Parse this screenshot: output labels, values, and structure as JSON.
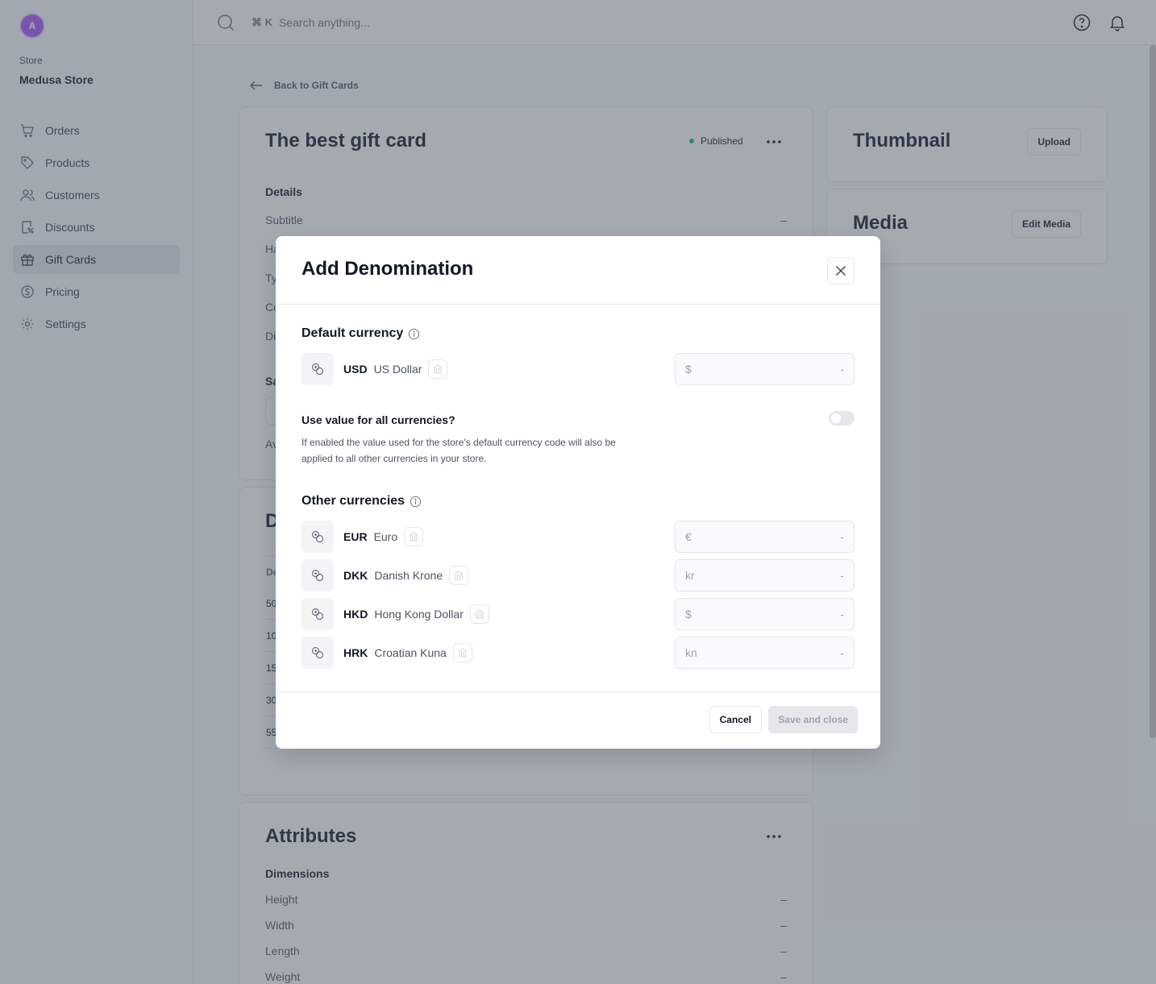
{
  "sidebar": {
    "avatar_initial": "A",
    "store_label": "Store",
    "store_name": "Medusa Store",
    "items": [
      {
        "label": "Orders",
        "icon": "cart-icon"
      },
      {
        "label": "Products",
        "icon": "tag-icon"
      },
      {
        "label": "Customers",
        "icon": "users-icon"
      },
      {
        "label": "Discounts",
        "icon": "discount-icon"
      },
      {
        "label": "Gift Cards",
        "icon": "gift-icon",
        "active": true
      },
      {
        "label": "Pricing",
        "icon": "dollar-icon"
      },
      {
        "label": "Settings",
        "icon": "gear-icon"
      }
    ]
  },
  "topbar": {
    "shortcut": "⌘ K",
    "search_placeholder": "Search anything..."
  },
  "page": {
    "back_label": "Back to Gift Cards",
    "gift_card": {
      "title": "The best gift card",
      "status": "Published",
      "details_heading": "Details",
      "rows": [
        {
          "label": "Subtitle",
          "value": "–"
        },
        {
          "label": "Ha",
          "value": ""
        },
        {
          "label": "Ty",
          "value": ""
        },
        {
          "label": "Co",
          "value": ""
        },
        {
          "label": "Di",
          "value": ""
        }
      ],
      "sales_heading": "Sa",
      "available_label": "Av"
    },
    "denominations": {
      "title": "D",
      "column": "De",
      "rows": [
        "50",
        "10",
        "15",
        "30",
        "55"
      ]
    },
    "attributes": {
      "title": "Attributes",
      "dimensions_heading": "Dimensions",
      "rows": [
        {
          "label": "Height",
          "value": "–"
        },
        {
          "label": "Width",
          "value": "–"
        },
        {
          "label": "Length",
          "value": "–"
        },
        {
          "label": "Weight",
          "value": "–"
        }
      ]
    },
    "thumbnail": {
      "title": "Thumbnail",
      "button": "Upload"
    },
    "media": {
      "title": "Media",
      "button": "Edit Media"
    }
  },
  "modal": {
    "title": "Add Denomination",
    "default_heading": "Default currency",
    "default_currency": {
      "code": "USD",
      "name": "US Dollar",
      "symbol": "$",
      "placeholder": "-"
    },
    "toggle_label": "Use value for all currencies?",
    "toggle_on": false,
    "toggle_desc": "If enabled the value used for the store's default currency code will also be applied to all other currencies in your store.",
    "other_heading": "Other currencies",
    "other_currencies": [
      {
        "code": "EUR",
        "name": "Euro",
        "symbol": "€",
        "placeholder": "-"
      },
      {
        "code": "DKK",
        "name": "Danish Krone",
        "symbol": "kr",
        "placeholder": "-"
      },
      {
        "code": "HKD",
        "name": "Hong Kong Dollar",
        "symbol": "$",
        "placeholder": "-"
      },
      {
        "code": "HRK",
        "name": "Croatian Kuna",
        "symbol": "kn",
        "placeholder": "-"
      }
    ],
    "cancel_label": "Cancel",
    "save_label": "Save and close"
  },
  "colors": {
    "status_published": "#10B981",
    "avatar": "#A855F7",
    "overlay": "rgba(75,85,99,0.5)"
  }
}
